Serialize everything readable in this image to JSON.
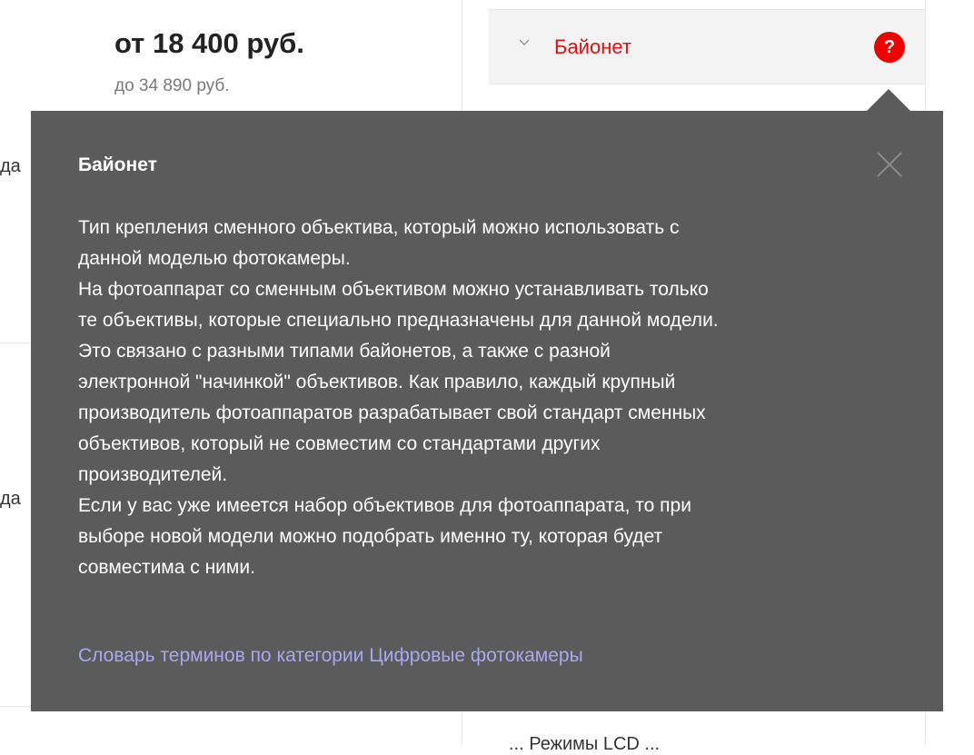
{
  "price": {
    "from": "от 18 400 руб.",
    "to": "до 34 890 руб."
  },
  "left_rows": {
    "row1_clip": "да",
    "row2_clip": "да"
  },
  "filter": {
    "label": "Байонет",
    "help_symbol": "?",
    "accent_color": "#e0100f"
  },
  "bottom_row": {
    "text": "... Режимы LCD ..."
  },
  "popup": {
    "title": "Байонет",
    "lines": [
      "Тип крепления сменного объектива, который можно использовать с",
      "данной моделью фотокамеры.",
      "На фотоаппарат со сменным объективом можно устанавливать только",
      "те объективы, которые специально предназначены для данной модели.",
      "Это связано с разными типами байонетов, а также с разной",
      "электронной \"начинкой\" объективов. Как правило, каждый крупный",
      "производитель фотоаппаратов разрабатывает свой стандарт сменных",
      "объективов, который не совместим со стандартами других",
      "производителей.",
      "Если у вас уже имеется набор объективов для фотоаппарата, то при",
      "выборе новой модели можно подобрать именно ту, которая будет",
      "совместима с ними."
    ],
    "glossary_link": "Словарь терминов по категории Цифровые фотокамеры",
    "close_icon": "close-icon",
    "background_color": "#5b5b5b",
    "link_color": "#a8a8f0"
  }
}
